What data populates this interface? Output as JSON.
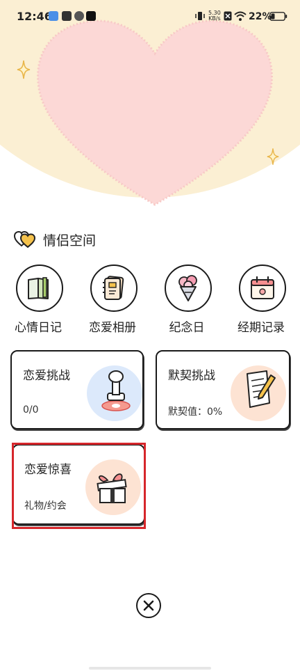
{
  "status_bar": {
    "time": "12:46",
    "net_speed_value": "5.30",
    "net_speed_unit": "KB/s",
    "battery": "22%"
  },
  "section": {
    "title": "情侣空间",
    "icon": "couple-hearts-icon"
  },
  "features": [
    {
      "label": "心情日记",
      "icon": "book-icon"
    },
    {
      "label": "恋爱相册",
      "icon": "album-icon"
    },
    {
      "label": "纪念日",
      "icon": "bouquet-icon"
    },
    {
      "label": "经期记录",
      "icon": "calendar-icon"
    }
  ],
  "cards": [
    {
      "title": "恋爱挑战",
      "subtitle": "0/0",
      "icon": "stamp-icon"
    },
    {
      "title": "默契挑战",
      "subtitle": "默契值：0%",
      "icon": "note-pen-icon"
    },
    {
      "title": "恋爱惊喜",
      "subtitle": "礼物/约会",
      "icon": "gift-icon"
    }
  ],
  "colors": {
    "cream": "#fbefd3",
    "heart_pink": "#fcd8d6",
    "accent_red": "#d6262b",
    "blue_blob": "#dce9fb",
    "peach_blob": "#fde3d3"
  },
  "close_icon": "close-icon"
}
